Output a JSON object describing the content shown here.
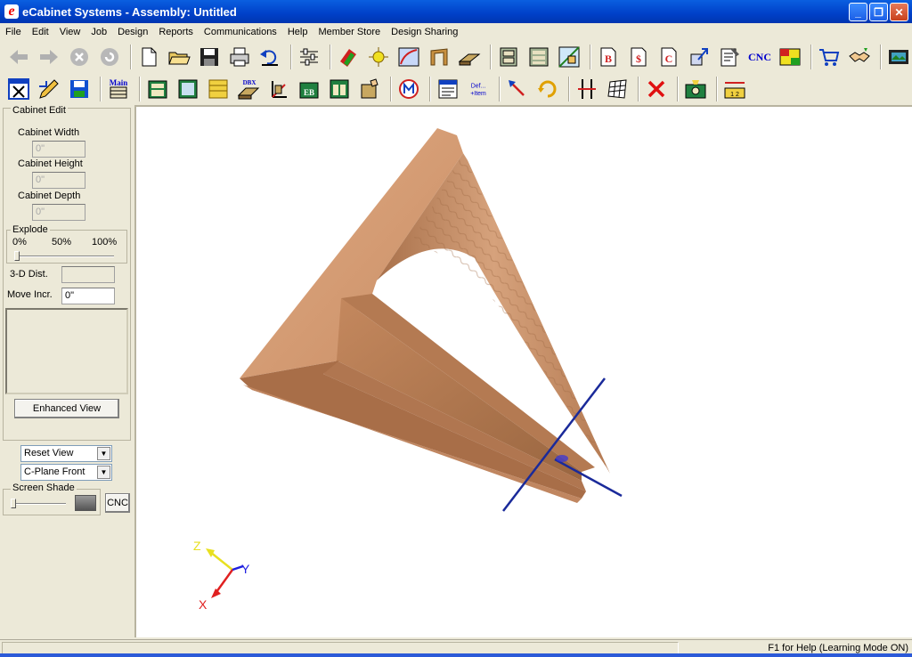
{
  "window": {
    "title": "eCabinet Systems - Assembly: Untitled",
    "logo": "e",
    "minimize": "_",
    "maximize": "❐",
    "close": "✕"
  },
  "menu": [
    "File",
    "Edit",
    "View",
    "Job",
    "Design",
    "Reports",
    "Communications",
    "Help",
    "Member Store",
    "Design Sharing"
  ],
  "toolbar1": {
    "cnc_label": "CNC",
    "report_b": "B",
    "report_s": "$",
    "report_c": "C",
    "help_glyph": "?"
  },
  "toolbar2": {
    "main_label": "Main",
    "dbx_label": "DBX",
    "eb_label": "EB",
    "def_label": "Def...",
    "item_label": "+Item",
    "ruler_label": "1 2"
  },
  "left_panel": {
    "group_title": "Cabinet Edit",
    "width_label": "Cabinet Width",
    "width_value": "0\"",
    "height_label": "Cabinet Height",
    "height_value": "0\"",
    "depth_label": "Cabinet Depth",
    "depth_value": "0\"",
    "explode_title": "Explode",
    "explode_ticks": [
      "0%",
      "50%",
      "100%"
    ],
    "explode_level": 0,
    "dist_label": "3-D Dist.",
    "dist_value": "",
    "move_label": "Move Incr.",
    "move_value": "0\"",
    "enhanced_view": "Enhanced View",
    "view_select": "Reset View",
    "plane_select": "C-Plane Front",
    "shade_title": "Screen Shade",
    "cnc_button": "CNC"
  },
  "viewport": {
    "axis_x": "X",
    "axis_y": "Y",
    "axis_z": "Z",
    "colors": {
      "x": "#e02020",
      "y": "#2020e0",
      "z": "#e8e020",
      "wood": "#d49a72",
      "crosshair": "#1a2a9a"
    }
  },
  "status": {
    "right_text": "F1 for Help (Learning Mode ON)"
  }
}
